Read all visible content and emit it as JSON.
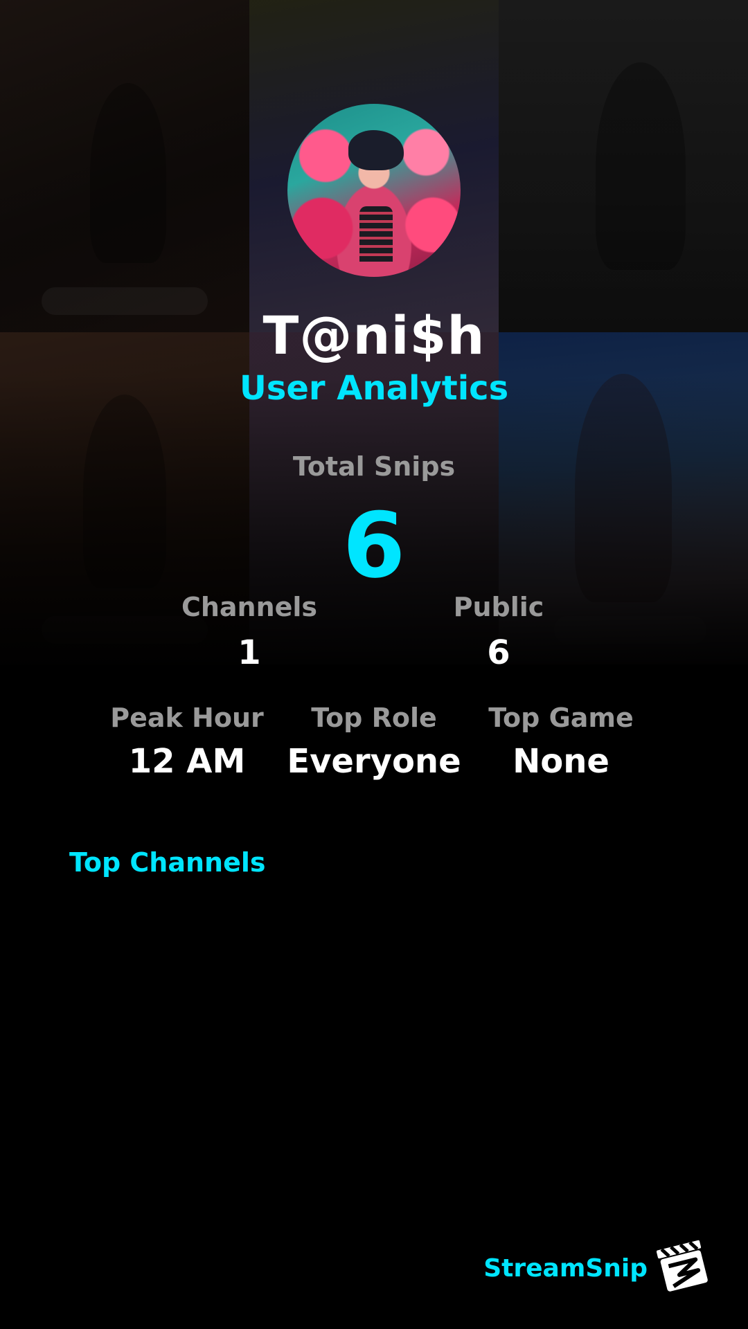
{
  "profile": {
    "username": "T@ni$h",
    "subtitle": "User Analytics",
    "avatar_description": "avatar"
  },
  "stats": {
    "total_label": "Total Snips",
    "total_value": "6",
    "channels_label": "Channels",
    "channels_value": "1",
    "public_label": "Public",
    "public_value": "6",
    "peak_hour_label": "Peak Hour",
    "peak_hour_value": "12 AM",
    "top_role_label": "Top Role",
    "top_role_value": "Everyone",
    "top_game_label": "Top Game",
    "top_game_value": "None"
  },
  "sections": {
    "top_channels_label": "Top Channels"
  },
  "footer": {
    "brand_name": "StreamSnip",
    "logo_icon": "clapperboard-icon"
  },
  "colors": {
    "accent": "#00e5ff",
    "label": "#9a9a9a",
    "background": "#000000"
  }
}
